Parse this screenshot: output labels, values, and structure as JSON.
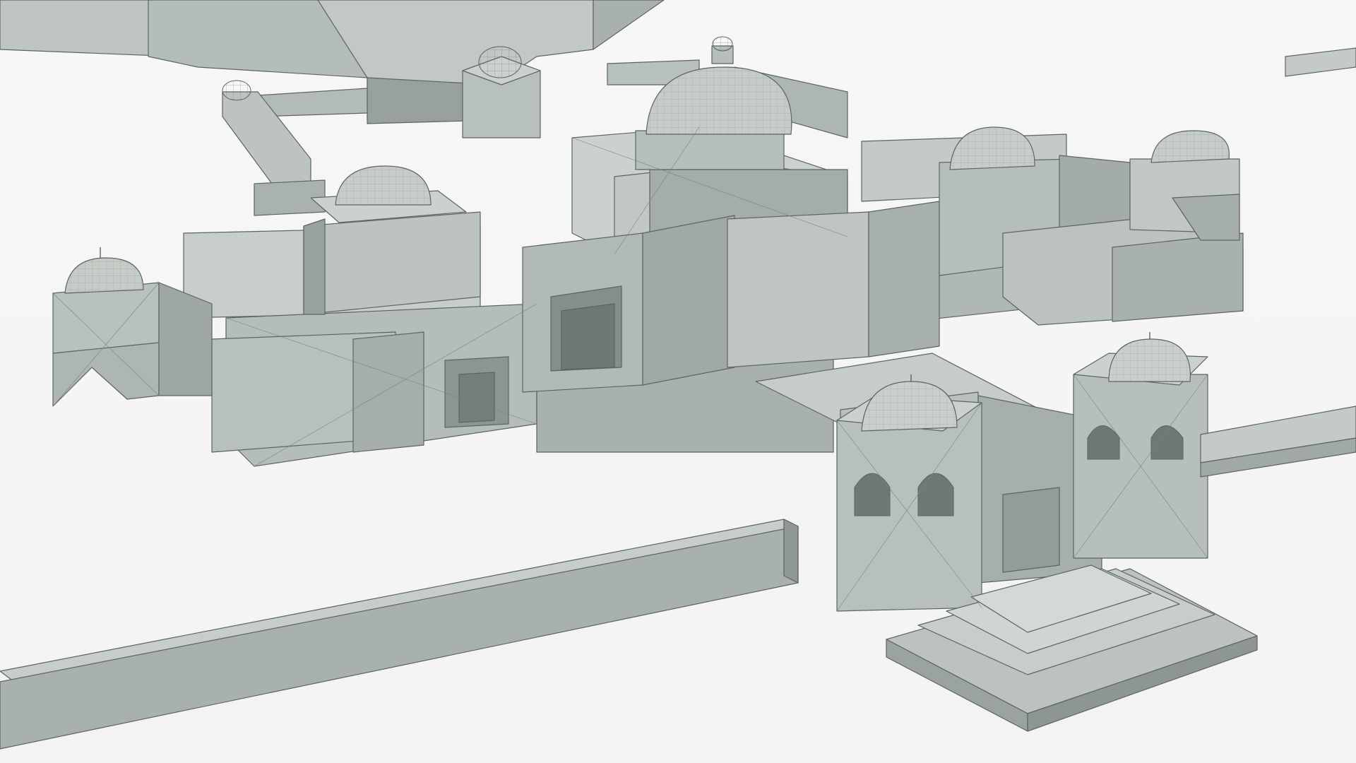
{
  "scene": {
    "description_visible_text": "",
    "colors": {
      "background": "#f4f4f4",
      "top_face": "#c7cec9",
      "light_face": "#bfc6c1",
      "mid_face": "#a9b1ac",
      "dark_face": "#8f9893",
      "shadow_face": "#7b847f",
      "edge": "#5d6560"
    }
  }
}
